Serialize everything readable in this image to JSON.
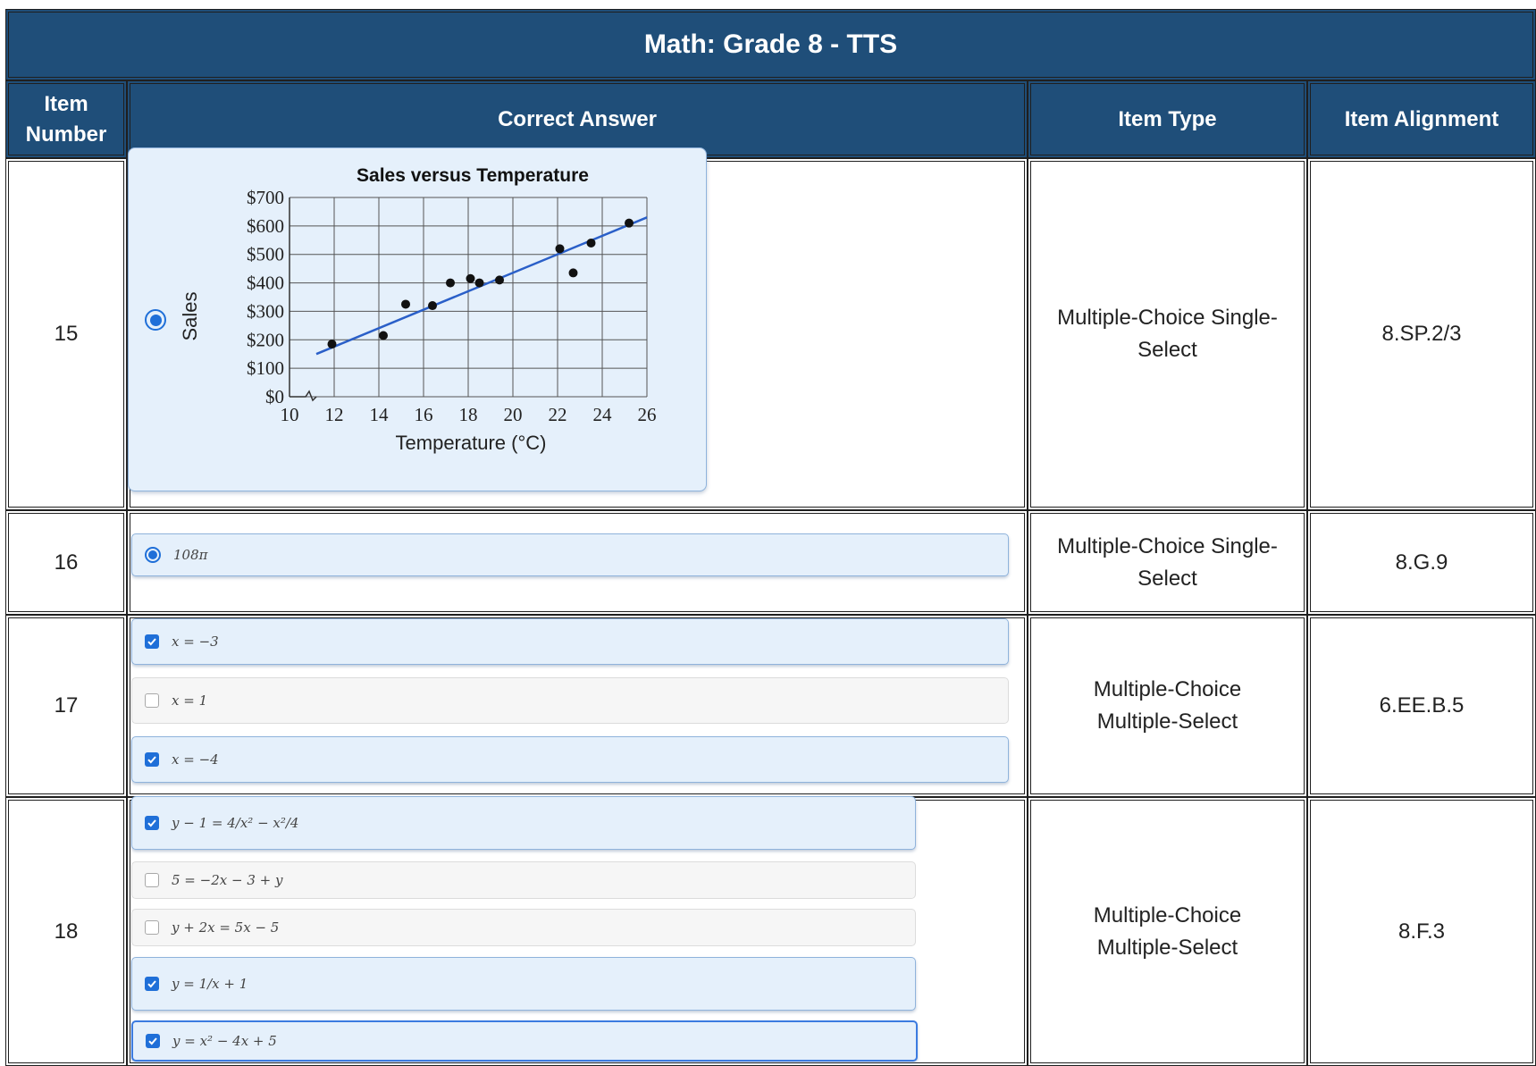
{
  "title": "Math: Grade 8 - TTS",
  "headers": {
    "item_number": "Item Number",
    "correct_answer": "Correct Answer",
    "item_type": "Item Type",
    "item_alignment": "Item Alignment"
  },
  "rows": [
    {
      "number": "15",
      "type": "Multiple-Choice Single-Select",
      "alignment": "8.SP.2/3",
      "answer": {
        "kind": "radio",
        "selected": true
      }
    },
    {
      "number": "16",
      "type": "Multiple-Choice Single-Select",
      "alignment": "8.G.9",
      "answer": {
        "kind": "radio",
        "selected": true,
        "text": "108π"
      }
    },
    {
      "number": "17",
      "type": "Multiple-Choice Multiple-Select",
      "alignment": "6.EE.B.5",
      "options": [
        {
          "text": "x = −3",
          "checked": true
        },
        {
          "text": "x = 1",
          "checked": false
        },
        {
          "text": "x = −4",
          "checked": true
        }
      ]
    },
    {
      "number": "18",
      "type": "Multiple-Choice Multiple-Select",
      "alignment": "8.F.3",
      "options": [
        {
          "text": "y − 1 = 4/x² − x²/4",
          "checked": true
        },
        {
          "text": "5 = −2x − 3 + y",
          "checked": false
        },
        {
          "text": "y + 2x = 5x − 5",
          "checked": false
        },
        {
          "text": "y = 1/x + 1",
          "checked": true
        },
        {
          "text": "y = x² − 4x + 5",
          "checked": true
        }
      ]
    }
  ],
  "chart_data": {
    "type": "scatter",
    "title": "Sales versus Temperature",
    "xlabel": "Temperature (°C)",
    "ylabel": "Sales",
    "xlim": [
      10,
      26
    ],
    "ylim": [
      0,
      700
    ],
    "x_ticks": [
      "10",
      "12",
      "14",
      "16",
      "18",
      "20",
      "22",
      "24",
      "26"
    ],
    "y_ticks": [
      "$0",
      "$100",
      "$200",
      "$300",
      "$400",
      "$500",
      "$600",
      "$700"
    ],
    "grid": true,
    "points": [
      {
        "x": 11.9,
        "y": 185
      },
      {
        "x": 14.2,
        "y": 215
      },
      {
        "x": 15.2,
        "y": 325
      },
      {
        "x": 16.4,
        "y": 320
      },
      {
        "x": 17.2,
        "y": 400
      },
      {
        "x": 18.1,
        "y": 415
      },
      {
        "x": 18.5,
        "y": 400
      },
      {
        "x": 19.4,
        "y": 410
      },
      {
        "x": 22.1,
        "y": 520
      },
      {
        "x": 22.7,
        "y": 435
      },
      {
        "x": 23.5,
        "y": 540
      },
      {
        "x": 25.2,
        "y": 610
      }
    ],
    "trend_line": {
      "x1": 11.2,
      "y1": 150,
      "x2": 26,
      "y2": 630
    },
    "colors": {
      "points": "#111111",
      "trend_line": "#2a5fc8"
    }
  },
  "colors": {
    "header_bg": "#1f4e79",
    "selected_bg": "#e5f0fb",
    "accent": "#1f6fd8"
  }
}
